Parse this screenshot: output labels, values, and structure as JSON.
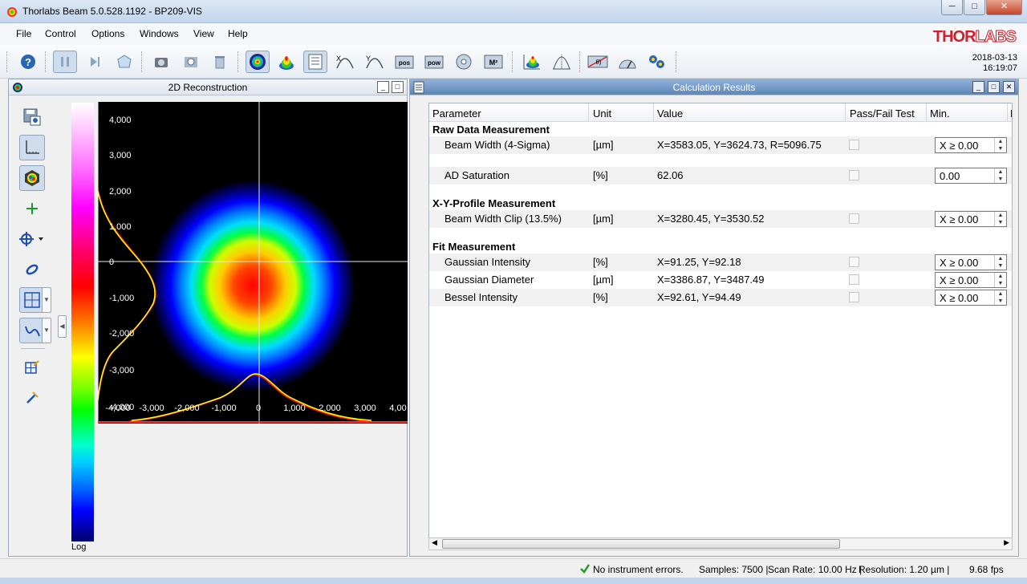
{
  "window": {
    "title": "Thorlabs Beam 5.0.528.1192 - BP209-VIS",
    "minimize": "─",
    "maximize": "□",
    "close": "✕"
  },
  "menu": [
    "File",
    "Control",
    "Options",
    "Windows",
    "View",
    "Help"
  ],
  "brand": {
    "part1": "THOR",
    "part2": "LABS"
  },
  "datetime": {
    "date": "2018-03-13",
    "time": "16:19:07"
  },
  "toolbar_labels": {
    "pos": "pos",
    "pow": "pow",
    "m2": "M²"
  },
  "left_panel": {
    "title": "2D Reconstruction",
    "scale_label": "Log",
    "y_ticks": [
      "4,000",
      "3,000",
      "2,000",
      "1,000",
      "0",
      "-1,000",
      "-2,000",
      "-3,000",
      "-4,000"
    ],
    "x_ticks": [
      "-4,000",
      "-3,000",
      "-2,000",
      "-1,000",
      "0",
      "1,000",
      "2,000",
      "3,000",
      "4,00"
    ]
  },
  "results_panel": {
    "title": "Calculation Results",
    "columns": [
      "Parameter",
      "Unit",
      "Value",
      "Pass/Fail Test",
      "Min.",
      "M"
    ],
    "sections": [
      {
        "title": "Raw Data Measurement"
      },
      {
        "title": "X-Y-Profile Measurement"
      },
      {
        "title": "Fit Measurement"
      }
    ],
    "rows": [
      {
        "param": "Beam Width (4-Sigma)",
        "unit": "[µm]",
        "value": "X=3583.05, Y=3624.73, R=5096.75",
        "min": "X ≥ 0.00"
      },
      {
        "param": "AD Saturation",
        "unit": "[%]",
        "value": "62.06",
        "min": "0.00"
      },
      {
        "param": "Beam Width Clip (13.5%)",
        "unit": "[µm]",
        "value": "X=3280.45, Y=3530.52",
        "min": "X ≥ 0.00"
      },
      {
        "param": "Gaussian Intensity",
        "unit": "[%]",
        "value": "X=91.25, Y=92.18",
        "min": "X ≥ 0.00"
      },
      {
        "param": "Gaussian Diameter",
        "unit": "[µm]",
        "value": "X=3386.87, Y=3487.49",
        "min": "X ≥ 0.00"
      },
      {
        "param": "Bessel Intensity",
        "unit": "[%]",
        "value": "X=92.61, Y=94.49",
        "min": "X ≥ 0.00"
      }
    ]
  },
  "status": {
    "errors": "No instrument errors.",
    "samples": "Samples: 7500 |",
    "scan_rate": "Scan Rate: 10.00 Hz |",
    "resolution": "Resolution: 1.20 µm |",
    "fps": "9.68 fps"
  },
  "colors": {
    "accent": "#5f86b7",
    "brand": "#d0202a",
    "crosshair": "#ffffff",
    "profile": "#ffff00"
  }
}
